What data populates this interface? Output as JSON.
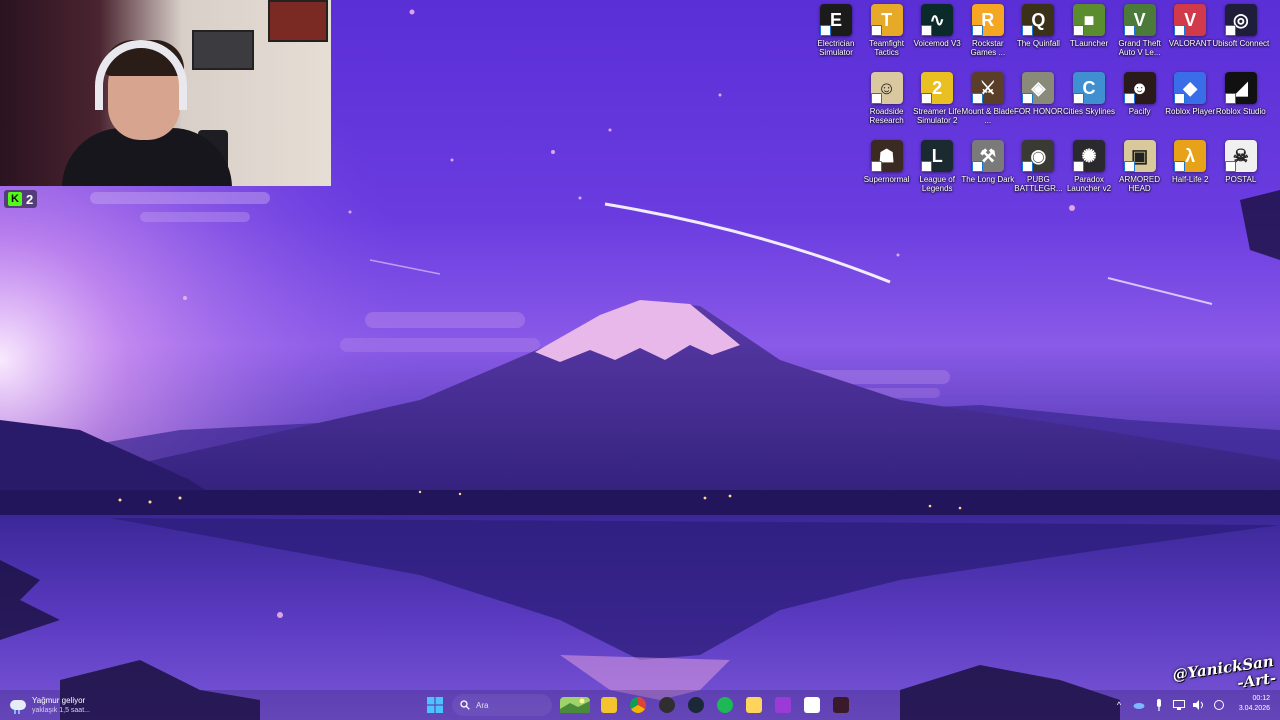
{
  "stream_overlay": {
    "kick_viewer_count": "2",
    "watermark_line1": "@YanickSan",
    "watermark_line2": "-Art-"
  },
  "desktop_icons": [
    {
      "label": "Electrician Simulator",
      "icon": "electrician-simulator-icon",
      "color": "#1b1b1b",
      "glyph": "E"
    },
    {
      "label": "Teamfight Tactics",
      "icon": "teamfight-tactics-icon",
      "color": "#e7a928",
      "glyph": "T"
    },
    {
      "label": "Voicemod V3",
      "icon": "voicemod-icon",
      "color": "#0b2b2b",
      "glyph": "∿"
    },
    {
      "label": "Rockstar Games ...",
      "icon": "rockstar-games-icon",
      "color": "#f5a623",
      "glyph": "R"
    },
    {
      "label": "The Quinfall",
      "icon": "quinfall-icon",
      "color": "#3a3118",
      "glyph": "Q"
    },
    {
      "label": "TLauncher",
      "icon": "tlauncher-icon",
      "color": "#5b8d2f",
      "glyph": "■"
    },
    {
      "label": "Grand Theft Auto V Le...",
      "icon": "gta-v-icon",
      "color": "#4c7a3a",
      "glyph": "V"
    },
    {
      "label": "VALORANT",
      "icon": "valorant-icon",
      "color": "#d13a4a",
      "glyph": "V"
    },
    {
      "label": "Ubisoft Connect",
      "icon": "ubisoft-connect-icon",
      "color": "#1e1e3a",
      "glyph": "◎"
    },
    {
      "label": "Roadside Research",
      "icon": "roadside-research-icon",
      "color": "#d9c8a0",
      "glyph": "☺"
    },
    {
      "label": "Streamer Life Simulator 2",
      "icon": "streamer-life-simulator-icon",
      "color": "#e8c022",
      "glyph": "2"
    },
    {
      "label": "Mount & Blade ...",
      "icon": "mount-and-blade-icon",
      "color": "#5a3e2a",
      "glyph": "⚔"
    },
    {
      "label": "FOR HONOR",
      "icon": "for-honor-icon",
      "color": "#8a8a7a",
      "glyph": "◈"
    },
    {
      "label": "Cities Skylines",
      "icon": "cities-skylines-icon",
      "color": "#3f8fd1",
      "glyph": "C"
    },
    {
      "label": "Pacify",
      "icon": "pacify-icon",
      "color": "#2a1a1a",
      "glyph": "☻"
    },
    {
      "label": "Roblox Player",
      "icon": "roblox-player-icon",
      "color": "#3a6ee8",
      "glyph": "◆"
    },
    {
      "label": "Roblox Studio",
      "icon": "roblox-studio-icon",
      "color": "#111111",
      "glyph": "◢"
    },
    {
      "label": "Supernormal",
      "icon": "supernormal-icon",
      "color": "#3a2a22",
      "glyph": "☗"
    },
    {
      "label": "League of Legends",
      "icon": "league-of-legends-icon",
      "color": "#1a2a30",
      "glyph": "L"
    },
    {
      "label": "The Long Dark",
      "icon": "the-long-dark-icon",
      "color": "#7a7a7a",
      "glyph": "⚒"
    },
    {
      "label": "PUBG BATTLEGR...",
      "icon": "pubg-icon",
      "color": "#3a3a34",
      "glyph": "◉"
    },
    {
      "label": "Paradox Launcher v2",
      "icon": "paradox-launcher-icon",
      "color": "#2a2a2e",
      "glyph": "✺"
    },
    {
      "label": "ARMORED HEAD",
      "icon": "armored-head-icon",
      "color": "#d9c89a",
      "glyph": "▣"
    },
    {
      "label": "Half-Life 2",
      "icon": "half-life-2-icon",
      "color": "#e8a21a",
      "glyph": "λ"
    },
    {
      "label": "POSTAL",
      "icon": "postal-icon",
      "color": "#f0f0f0",
      "glyph": "☠"
    }
  ],
  "taskbar": {
    "weather_title": "Yağmur geliyor",
    "weather_subtitle": "yaklaşık 1,5 saat...",
    "search_placeholder": "Ara",
    "pinned_apps": [
      {
        "name": "file-explorer",
        "icon": "folder-icon",
        "color": "#f4c430"
      },
      {
        "name": "chrome",
        "icon": "chrome-icon",
        "color": "#db4437"
      },
      {
        "name": "obs",
        "icon": "obs-icon",
        "color": "#302e31"
      },
      {
        "name": "steam",
        "icon": "steam-icon",
        "color": "#1b2838"
      },
      {
        "name": "spotify",
        "icon": "spotify-icon",
        "color": "#1db954"
      },
      {
        "name": "files",
        "icon": "folder-icon",
        "color": "#ffd45c"
      },
      {
        "name": "app-purple",
        "icon": "app-icon",
        "color": "#9b3bd6"
      },
      {
        "name": "store",
        "icon": "store-icon",
        "color": "#ffffff"
      },
      {
        "name": "app-dark",
        "icon": "app-icon",
        "color": "#3a1a2a"
      }
    ],
    "clock_time": "00:12",
    "clock_date": "3.04.2026"
  }
}
